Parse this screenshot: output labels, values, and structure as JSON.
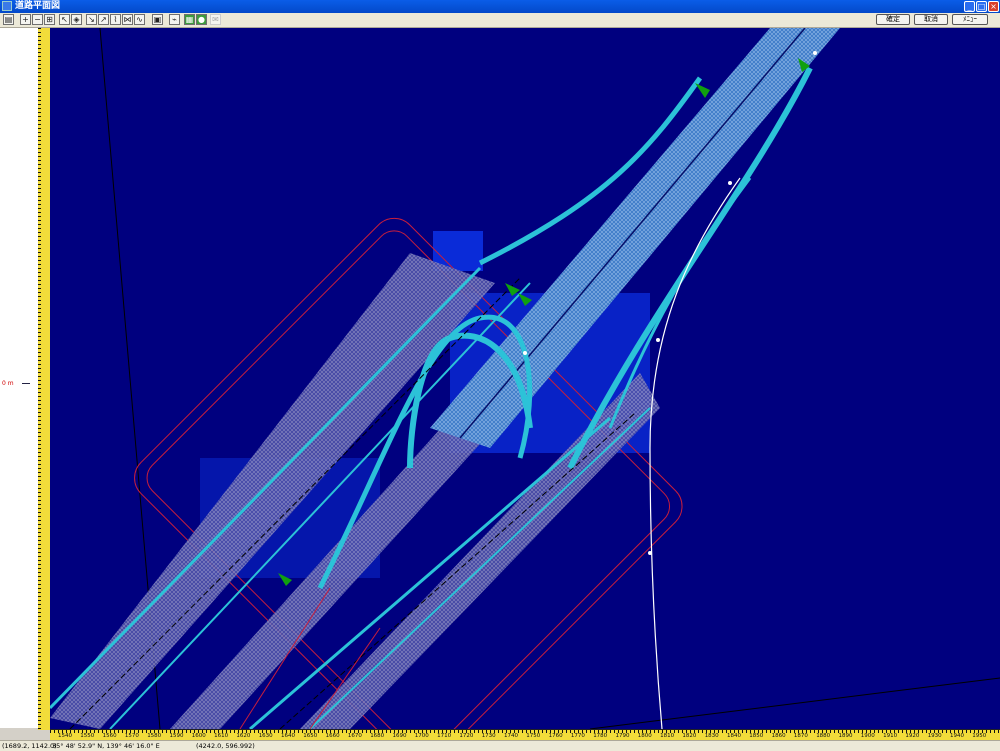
{
  "window": {
    "title": "道路平面図",
    "minimize": "_",
    "maximize": "□",
    "close": "×"
  },
  "toolbar": {
    "ok_label": "確定",
    "cancel_label": "取消",
    "extra_label": "ﾒﾆｭｰ"
  },
  "left_panel": {
    "zero_label": "0 m"
  },
  "ruler_bottom": {
    "labels": [
      "1540",
      "1550",
      "1560",
      "1570",
      "1580",
      "1590",
      "1600",
      "1610",
      "1620",
      "1630",
      "1640",
      "1650",
      "1660",
      "1670",
      "1680",
      "1690",
      "1700",
      "1710",
      "1720",
      "1730",
      "1740",
      "1750",
      "1760",
      "1770",
      "1780",
      "1790",
      "1800",
      "1810",
      "1820",
      "1830",
      "1840",
      "1850",
      "1860",
      "1870",
      "1880",
      "1890",
      "1900",
      "1910",
      "1920",
      "1930",
      "1940",
      "1950"
    ]
  },
  "status": {
    "coords": "(1689.2, 1142.0)",
    "latlon": "35° 48' 52.9\" N, 139° 46' 16.0\" E",
    "xy": "(4242.0, 596.992)"
  },
  "colors": {
    "background": "#00007f",
    "road_fill": "#3a7fd0",
    "road_edge": "#22c8d8",
    "boundary": "#c81e3c",
    "centerline": "#ffffff",
    "marker": "#10a010"
  }
}
